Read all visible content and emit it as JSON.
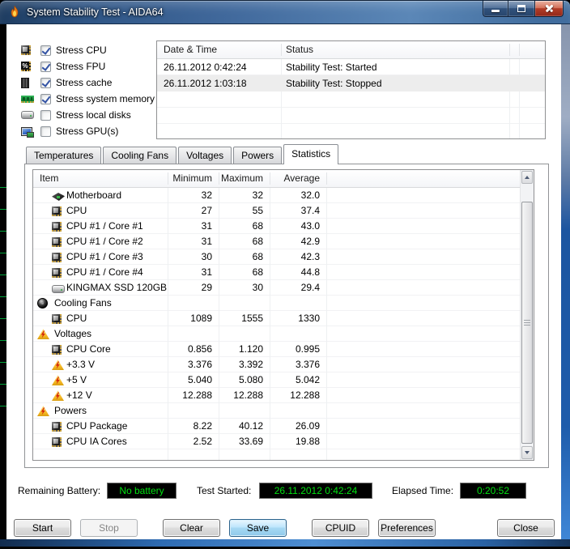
{
  "window": {
    "title": "System Stability Test - AIDA64",
    "app_icon": "flame-icon",
    "caption_icons": [
      "minimize-icon",
      "maximize-icon",
      "close-icon"
    ]
  },
  "stress_options": [
    {
      "label": "Stress CPU",
      "checked": true,
      "icon": "cpu-chip-icon"
    },
    {
      "label": "Stress FPU",
      "checked": true,
      "icon": "fpu-chip-icon"
    },
    {
      "label": "Stress cache",
      "checked": true,
      "icon": "cache-chip-icon"
    },
    {
      "label": "Stress system memory",
      "checked": true,
      "icon": "memory-module-icon"
    },
    {
      "label": "Stress local disks",
      "checked": false,
      "icon": "disk-drive-icon"
    },
    {
      "label": "Stress GPU(s)",
      "checked": false,
      "icon": "gpu-monitor-icon"
    }
  ],
  "log": {
    "columns": [
      "Date & Time",
      "Status"
    ],
    "rows": [
      {
        "datetime": "26.11.2012 0:42:24",
        "status": "Stability Test: Started",
        "selected": false
      },
      {
        "datetime": "26.11.2012 1:03:18",
        "status": "Stability Test: Stopped",
        "selected": true
      }
    ]
  },
  "tabs": [
    {
      "label": "Temperatures",
      "active": false
    },
    {
      "label": "Cooling Fans",
      "active": false
    },
    {
      "label": "Voltages",
      "active": false
    },
    {
      "label": "Powers",
      "active": false
    },
    {
      "label": "Statistics",
      "active": true
    }
  ],
  "stats": {
    "columns": [
      "Item",
      "Minimum",
      "Maximum",
      "Average"
    ],
    "rows": [
      {
        "type": "item",
        "icon": "motherboard-icon",
        "label": "Motherboard",
        "min": "32",
        "max": "32",
        "avg": "32.0"
      },
      {
        "type": "item",
        "icon": "cpu-chip-icon",
        "label": "CPU",
        "min": "27",
        "max": "55",
        "avg": "37.4"
      },
      {
        "type": "item",
        "icon": "cpu-chip-icon",
        "label": "CPU #1 / Core #1",
        "min": "31",
        "max": "68",
        "avg": "43.0"
      },
      {
        "type": "item",
        "icon": "cpu-chip-icon",
        "label": "CPU #1 / Core #2",
        "min": "31",
        "max": "68",
        "avg": "42.9"
      },
      {
        "type": "item",
        "icon": "cpu-chip-icon",
        "label": "CPU #1 / Core #3",
        "min": "30",
        "max": "68",
        "avg": "42.3"
      },
      {
        "type": "item",
        "icon": "cpu-chip-icon",
        "label": "CPU #1 / Core #4",
        "min": "31",
        "max": "68",
        "avg": "44.8"
      },
      {
        "type": "item",
        "icon": "disk-drive-icon",
        "label": "KINGMAX SSD 120GB",
        "min": "29",
        "max": "30",
        "avg": "29.4"
      },
      {
        "type": "group",
        "icon": "fan-icon",
        "label": "Cooling Fans"
      },
      {
        "type": "item",
        "icon": "cpu-chip-icon",
        "label": "CPU",
        "min": "1089",
        "max": "1555",
        "avg": "1330"
      },
      {
        "type": "group",
        "icon": "warning-icon",
        "label": "Voltages"
      },
      {
        "type": "item",
        "icon": "cpu-chip-icon",
        "label": "CPU Core",
        "min": "0.856",
        "max": "1.120",
        "avg": "0.995"
      },
      {
        "type": "item",
        "icon": "warning-icon",
        "label": "+3.3 V",
        "min": "3.376",
        "max": "3.392",
        "avg": "3.376"
      },
      {
        "type": "item",
        "icon": "warning-icon",
        "label": "+5 V",
        "min": "5.040",
        "max": "5.080",
        "avg": "5.042"
      },
      {
        "type": "item",
        "icon": "warning-icon",
        "label": "+12 V",
        "min": "12.288",
        "max": "12.288",
        "avg": "12.288"
      },
      {
        "type": "group",
        "icon": "warning-icon",
        "label": "Powers"
      },
      {
        "type": "item",
        "icon": "cpu-chip-icon",
        "label": "CPU Package",
        "min": "8.22",
        "max": "40.12",
        "avg": "26.09"
      },
      {
        "type": "item",
        "icon": "cpu-chip-icon",
        "label": "CPU IA Cores",
        "min": "2.52",
        "max": "33.69",
        "avg": "19.88"
      }
    ]
  },
  "status_bar": {
    "battery_label": "Remaining Battery:",
    "battery_value": "No battery",
    "test_started_label": "Test Started:",
    "test_started_value": "26.11.2012 0:42:24",
    "elapsed_label": "Elapsed Time:",
    "elapsed_value": "0:20:52",
    "value_color": "#00e010"
  },
  "buttons": [
    {
      "label": "Start",
      "disabled": false,
      "focused": false
    },
    {
      "label": "Stop",
      "disabled": true,
      "focused": false
    },
    {
      "label": "Clear",
      "disabled": false,
      "focused": false
    },
    {
      "label": "Save",
      "disabled": false,
      "focused": true
    },
    {
      "label": "CPUID",
      "disabled": false,
      "focused": false
    },
    {
      "label": "Preferences",
      "disabled": false,
      "focused": false
    },
    {
      "label": "Close",
      "disabled": false,
      "focused": false
    }
  ],
  "colors": {
    "titlebar_accent": "#41699c",
    "status_text_green": "#00e010",
    "selection_gray": "#ededed"
  }
}
